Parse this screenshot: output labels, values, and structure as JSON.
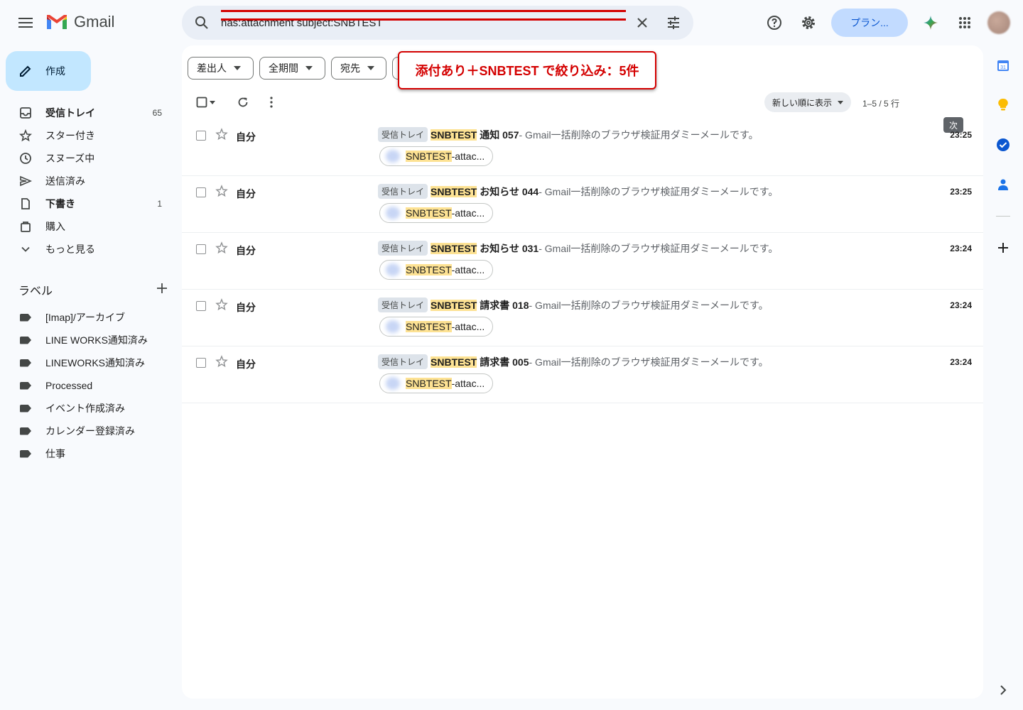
{
  "app": {
    "name": "Gmail"
  },
  "search": {
    "query": "has:attachment subject:SNBTEST"
  },
  "top": {
    "plan_label": "プラン..."
  },
  "compose": {
    "label": "作成"
  },
  "nav": {
    "items": [
      {
        "label": "受信トレイ",
        "count": "65",
        "icon": "inbox-icon",
        "bold": true
      },
      {
        "label": "スター付き",
        "count": "",
        "icon": "star-icon",
        "bold": false
      },
      {
        "label": "スヌーズ中",
        "count": "",
        "icon": "clock-icon",
        "bold": false
      },
      {
        "label": "送信済み",
        "count": "",
        "icon": "send-icon",
        "bold": false
      },
      {
        "label": "下書き",
        "count": "1",
        "icon": "draft-icon",
        "bold": true
      },
      {
        "label": "購入",
        "count": "",
        "icon": "bag-icon",
        "bold": false
      },
      {
        "label": "もっと見る",
        "count": "",
        "icon": "chevron-down-icon",
        "bold": false
      }
    ]
  },
  "labels": {
    "heading": "ラベル",
    "items": [
      "[Imap]/アーカイブ",
      "LINE WORKS通知済み",
      "LINEWORKS通知済み",
      "Processed",
      "イベント作成済み",
      "カレンダー登録済み",
      "仕事"
    ]
  },
  "filters": {
    "chips": [
      "差出人",
      "全期間",
      "宛先"
    ]
  },
  "callout": {
    "text": "添付あり＋SNBTEST で絞り込み：5件"
  },
  "toolbar": {
    "sort_label": "新しい順に表示",
    "range": "1–5 / 5 行",
    "tooltip": "次"
  },
  "emails": [
    {
      "sender": "自分",
      "badge": "受信トレイ",
      "tag": "SNBTEST",
      "subject": "通知 057",
      "snippet": " - Gmail一括削除のブラウザ検証用ダミーメールです。",
      "time": "23:25",
      "attach_hl": "SNBTEST",
      "attach_rest": "-attac..."
    },
    {
      "sender": "自分",
      "badge": "受信トレイ",
      "tag": "SNBTEST",
      "subject": "お知らせ 044",
      "snippet": " - Gmail一括削除のブラウザ検証用ダミーメールです。",
      "time": "23:25",
      "attach_hl": "SNBTEST",
      "attach_rest": "-attac..."
    },
    {
      "sender": "自分",
      "badge": "受信トレイ",
      "tag": "SNBTEST",
      "subject": "お知らせ 031",
      "snippet": " - Gmail一括削除のブラウザ検証用ダミーメールです。",
      "time": "23:24",
      "attach_hl": "SNBTEST",
      "attach_rest": "-attac..."
    },
    {
      "sender": "自分",
      "badge": "受信トレイ",
      "tag": "SNBTEST",
      "subject": "請求書 018",
      "snippet": " - Gmail一括削除のブラウザ検証用ダミーメールです。",
      "time": "23:24",
      "attach_hl": "SNBTEST",
      "attach_rest": "-attac..."
    },
    {
      "sender": "自分",
      "badge": "受信トレイ",
      "tag": "SNBTEST",
      "subject": "請求書 005",
      "snippet": " - Gmail一括削除のブラウザ検証用ダミーメールです。",
      "time": "23:24",
      "attach_hl": "SNBTEST",
      "attach_rest": "-attac..."
    }
  ],
  "colors": {
    "accent": "#0b57d0",
    "annotation": "#d40000",
    "highlight": "#fde293"
  }
}
